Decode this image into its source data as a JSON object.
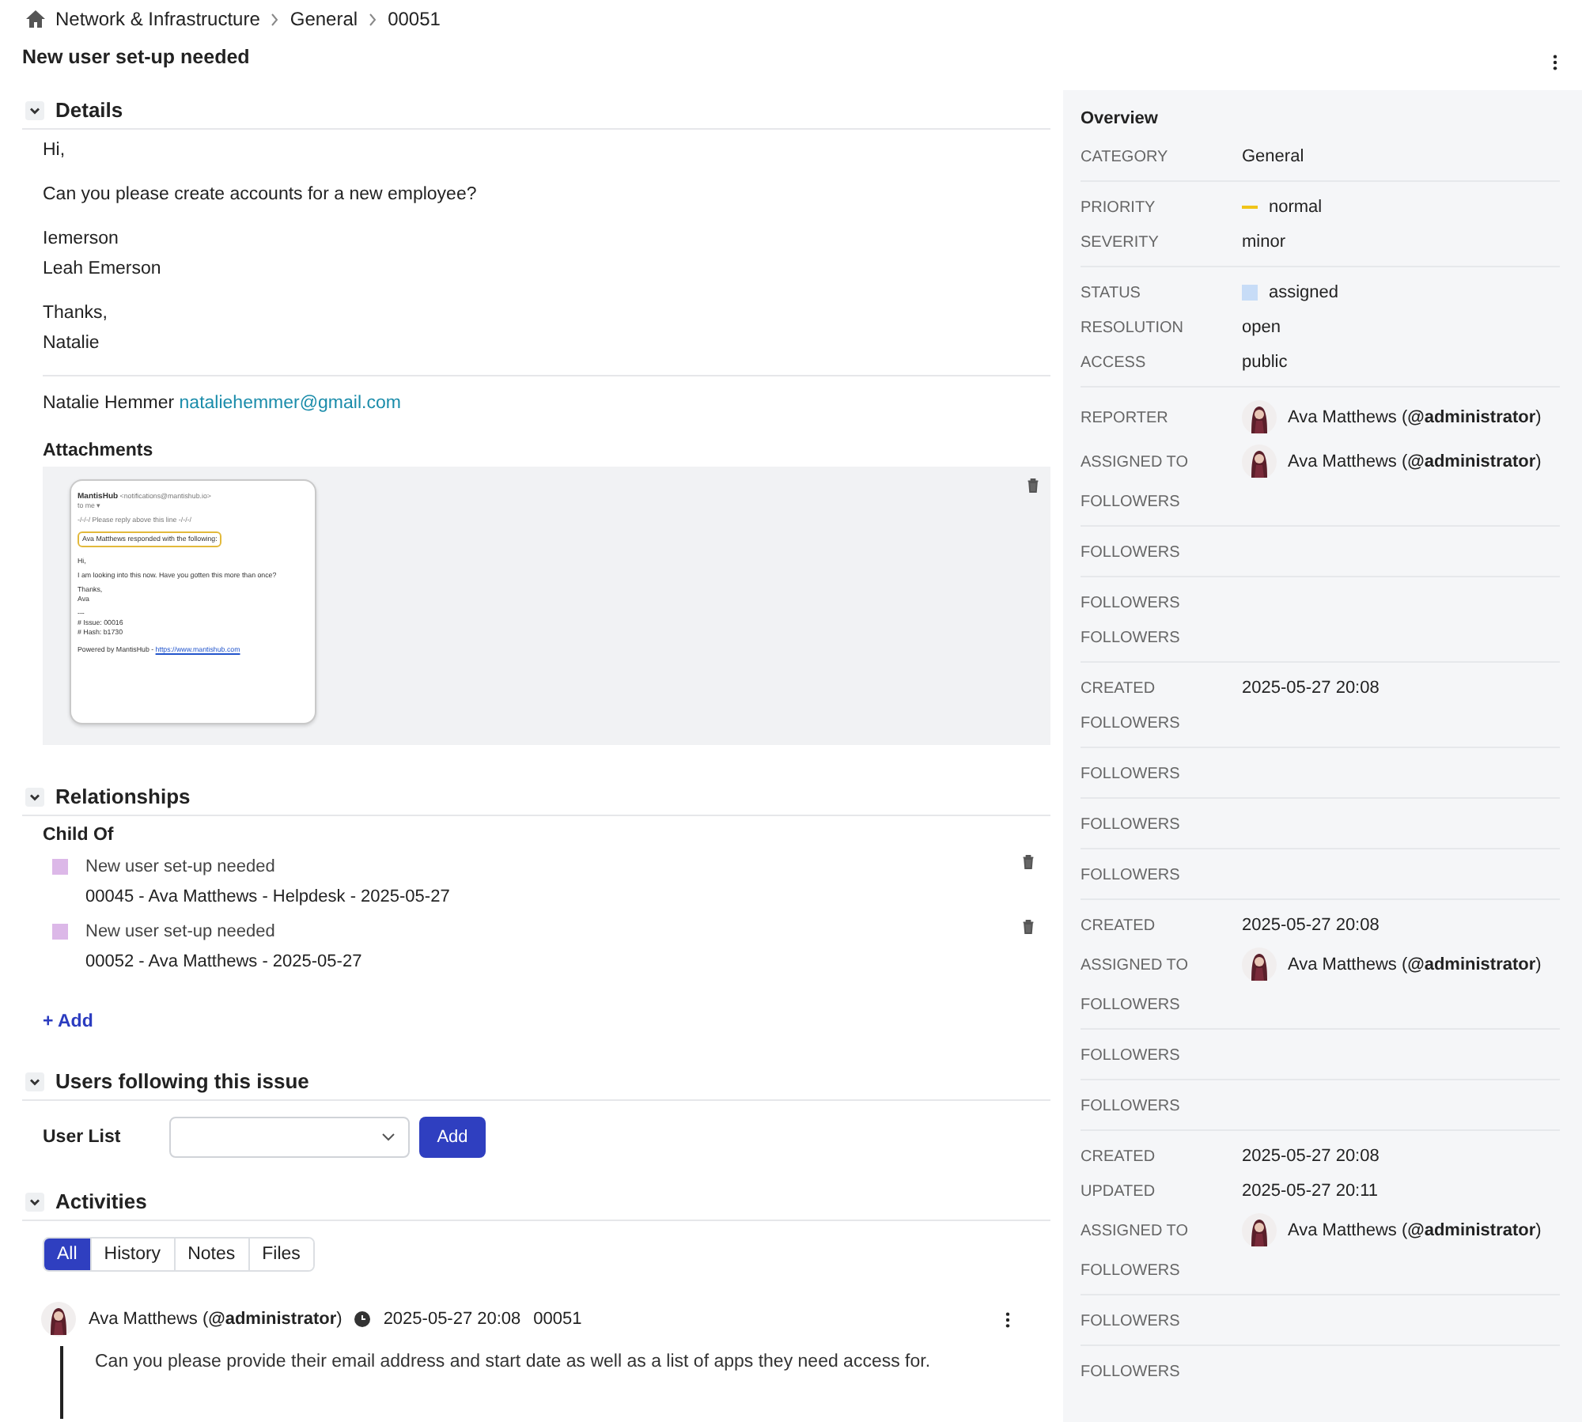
{
  "breadcrumb": [
    "Network & Infrastructure",
    "General",
    "00051"
  ],
  "title": "New user set-up needed",
  "details": {
    "heading": "Details",
    "paragraphs": [
      [
        "Hi,"
      ],
      [
        "Can you please create accounts for a new employee?"
      ],
      [
        "Iemerson",
        "Leah Emerson"
      ],
      [
        "Thanks,",
        "Natalie"
      ]
    ],
    "signature_name": "Natalie Hemmer",
    "signature_email": "nataliehemmer@gmail.com",
    "attachments_heading": "Attachments",
    "email_preview": {
      "sender": "MantisHub",
      "sender_email": "<notifications@mantishub.io>",
      "to": "to me ▾",
      "reply_line": "-/-/-/ Please reply above this line -/-/-/",
      "highlight": "Ava Matthews responded with the following:",
      "paragraphs": [
        [
          "Hi,"
        ],
        [
          "I am looking into this now. Have you gotten this more than once?"
        ],
        [
          "Thanks,",
          "Ava"
        ],
        [
          "---",
          "# Issue: 00016",
          "# Hash: b1730"
        ]
      ],
      "footer": "Powered by MantisHub - ",
      "footer_link": "https://www.mantishub.com"
    }
  },
  "relationships": {
    "heading": "Relationships",
    "group": "Child Of",
    "items": [
      {
        "title": "New user set-up needed",
        "subtitle": "00045 - Ava Matthews - Helpdesk - 2025-05-27",
        "color": "#dcb8e8"
      },
      {
        "title": "New user set-up needed",
        "subtitle": "00052 - Ava Matthews - 2025-05-27",
        "color": "#dcb8e8"
      }
    ],
    "add": "+ Add"
  },
  "followers": {
    "heading": "Users following this issue",
    "label": "User List",
    "button": "Add"
  },
  "activities": {
    "heading": "Activities",
    "tabs": [
      {
        "label": "All",
        "selected": true
      },
      {
        "label": "History",
        "selected": false
      },
      {
        "label": "Notes",
        "selected": false
      },
      {
        "label": "Files",
        "selected": false
      }
    ],
    "entry": {
      "author": "Ava Matthews (**@administrator**)",
      "time": "2025-05-27 20:08",
      "id": "00051",
      "text": "Can you please provide their email address and start date as well as a list of apps they need access for."
    }
  },
  "overview": {
    "title": "Overview",
    "rows": [
      {
        "label": "CATEGORY",
        "kind": "text",
        "value": "General",
        "group_end": true
      },
      {
        "label": "PRIORITY",
        "kind": "priority",
        "value": "normal",
        "group_end": false
      },
      {
        "label": "SEVERITY",
        "kind": "text",
        "value": "minor",
        "group_end": true
      },
      {
        "label": "STATUS",
        "kind": "status",
        "value": "assigned",
        "group_end": false
      },
      {
        "label": "RESOLUTION",
        "kind": "text",
        "value": "open",
        "group_end": false
      },
      {
        "label": "ACCESS",
        "kind": "text",
        "value": "public",
        "group_end": true
      },
      {
        "label": "REPORTER",
        "kind": "user",
        "value": "Ava Matthews (**@administrator**)",
        "group_end": false
      },
      {
        "label": "ASSIGNED TO",
        "kind": "user",
        "value": "Ava Matthews (**@administrator**)",
        "group_end": false
      },
      {
        "label": "FOLLOWERS",
        "kind": "empty",
        "group_end": true
      },
      {
        "label": "FOLLOWERS",
        "kind": "empty",
        "group_end": true
      },
      {
        "label": "FOLLOWERS",
        "kind": "empty",
        "group_end": false
      },
      {
        "label": "FOLLOWERS",
        "kind": "empty",
        "group_end": true
      },
      {
        "label": "CREATED",
        "kind": "text",
        "value": "2025-05-27 20:08",
        "group_end": false
      },
      {
        "label": "FOLLOWERS",
        "kind": "empty",
        "group_end": true
      },
      {
        "label": "FOLLOWERS",
        "kind": "empty",
        "group_end": true
      },
      {
        "label": "FOLLOWERS",
        "kind": "empty",
        "group_end": true
      },
      {
        "label": "FOLLOWERS",
        "kind": "empty",
        "group_end": true
      },
      {
        "label": "CREATED",
        "kind": "text",
        "value": "2025-05-27 20:08",
        "group_end": false
      },
      {
        "label": "ASSIGNED TO",
        "kind": "user",
        "value": "Ava Matthews (**@administrator**)",
        "group_end": false
      },
      {
        "label": "FOLLOWERS",
        "kind": "empty",
        "group_end": true
      },
      {
        "label": "FOLLOWERS",
        "kind": "empty",
        "group_end": true
      },
      {
        "label": "FOLLOWERS",
        "kind": "empty",
        "group_end": true
      },
      {
        "label": "CREATED",
        "kind": "text",
        "value": "2025-05-27 20:08",
        "group_end": false
      },
      {
        "label": "UPDATED",
        "kind": "text",
        "value": "2025-05-27 20:11",
        "group_end": false
      },
      {
        "label": "ASSIGNED TO",
        "kind": "user",
        "value": "Ava Matthews (**@administrator**)",
        "group_end": false
      },
      {
        "label": "FOLLOWERS",
        "kind": "empty",
        "group_end": true
      },
      {
        "label": "FOLLOWERS",
        "kind": "empty",
        "group_end": true
      },
      {
        "label": "FOLLOWERS",
        "kind": "empty",
        "group_end": false
      }
    ]
  }
}
